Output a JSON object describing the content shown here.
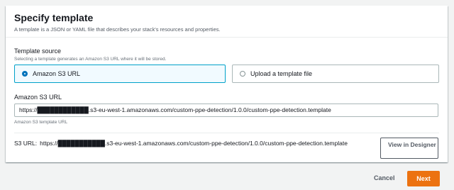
{
  "header": {
    "title": "Specify template",
    "description": "A template is a JSON or YAML file that describes your stack's resources and properties."
  },
  "template_source": {
    "label": "Template source",
    "description": "Selecting a template generates an Amazon S3 URL where it will be stored.",
    "options": [
      {
        "label": "Amazon S3 URL",
        "selected": true
      },
      {
        "label": "Upload a template file",
        "selected": false
      }
    ]
  },
  "s3_url_field": {
    "label": "Amazon S3 URL",
    "value": "https://████████████.s3-eu-west-1.amazonaws.com/custom-ppe-detection/1.0.0/custom-ppe-detection.template",
    "help": "Amazon S3 template URL"
  },
  "s3_summary": {
    "key": "S3 URL:",
    "value": "https://███████████.s3-eu-west-1.amazonaws.com/custom-ppe-detection/1.0.0/custom-ppe-detection.template",
    "designer_button": "View in Designer"
  },
  "footer": {
    "cancel": "Cancel",
    "next": "Next"
  },
  "colors": {
    "primary": "#ec7211",
    "selected_border": "#00a1c9",
    "radio_checked": "#0073bb"
  }
}
